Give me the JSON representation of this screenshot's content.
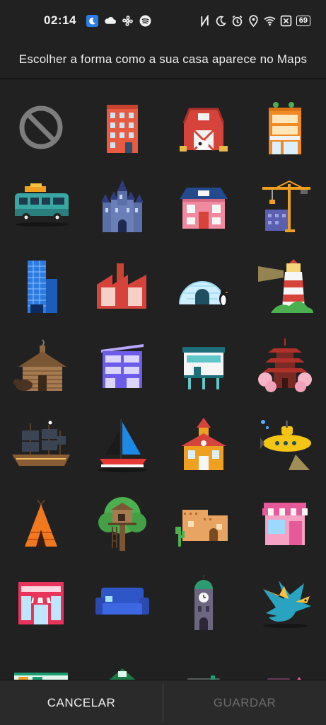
{
  "status": {
    "time": "02:14",
    "battery": "69",
    "icons": [
      "moon-badge-icon",
      "cloud-icon",
      "fan-icon",
      "spotify-icon",
      "nfc-icon",
      "do-not-disturb-icon",
      "alarm-icon",
      "location-icon",
      "wifi-icon",
      "close-box-icon"
    ]
  },
  "header": {
    "title": "Escolher a forma como a sua casa aparece no Maps"
  },
  "options": [
    "none",
    "apartment",
    "barn",
    "shop-building",
    "camper-van",
    "castle",
    "cottage",
    "construction-crane",
    "skyscraper",
    "factory",
    "igloo",
    "lighthouse",
    "log-cabin",
    "modern-house",
    "stilt-house",
    "pagoda",
    "pirate-ship",
    "sailboat",
    "schoolhouse",
    "submarine",
    "teepee",
    "treehouse",
    "adobe-house",
    "storefront",
    "circus-shop",
    "sofa",
    "clock-tower",
    "dragon",
    "green-store",
    "green-house",
    "grey-house",
    "pink-house"
  ],
  "footer": {
    "cancel_label": "CANCELAR",
    "save_label": "GUARDAR"
  },
  "colors": {
    "background": "#212121",
    "bar": "#2a2a2a",
    "disabled": "#6b6b6b"
  }
}
